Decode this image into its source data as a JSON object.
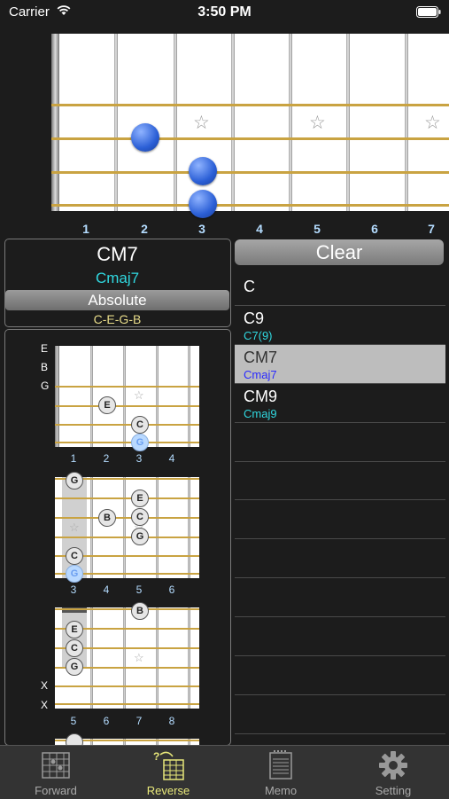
{
  "status": {
    "carrier": "Carrier",
    "time": "3:50 PM"
  },
  "fretboard": {
    "fret_numbers": [
      "1",
      "2",
      "3",
      "4",
      "5",
      "6",
      "7"
    ]
  },
  "chord": {
    "name": "CM7",
    "alias": "Cmaj7",
    "mode_label": "Absolute",
    "notes": "C-E-G-B"
  },
  "clear_label": "Clear",
  "chord_list": [
    {
      "name": "C",
      "alias": "",
      "alias_color": "#30d8e0"
    },
    {
      "name": "C9",
      "alias": "C7(9)",
      "alias_color": "#30d8e0"
    },
    {
      "name": "CM7",
      "alias": "Cmaj7",
      "alias_color": "#2a2aff",
      "selected": true
    },
    {
      "name": "CM9",
      "alias": "Cmaj9",
      "alias_color": "#30d8e0"
    }
  ],
  "diagrams": [
    {
      "string_labels": [
        "E",
        "B",
        "G"
      ],
      "fret_numbers": [
        "1",
        "2",
        "3",
        "4"
      ],
      "notes": [
        "E",
        "C",
        "G"
      ]
    },
    {
      "fret_numbers": [
        "3",
        "4",
        "5",
        "6"
      ],
      "notes": [
        "G",
        "B",
        "E",
        "C",
        "G",
        "C",
        "G"
      ]
    },
    {
      "string_labels": [
        "X",
        "X"
      ],
      "fret_numbers": [
        "5",
        "6",
        "7",
        "8"
      ],
      "notes": [
        "B",
        "E",
        "C",
        "G"
      ]
    }
  ],
  "tabs": [
    {
      "label": "Forward",
      "icon": "fretboard-grid-icon"
    },
    {
      "label": "Reverse",
      "icon": "reverse-lookup-icon",
      "active": true
    },
    {
      "label": "Memo",
      "icon": "memo-icon"
    },
    {
      "label": "Setting",
      "icon": "gear-icon"
    }
  ]
}
